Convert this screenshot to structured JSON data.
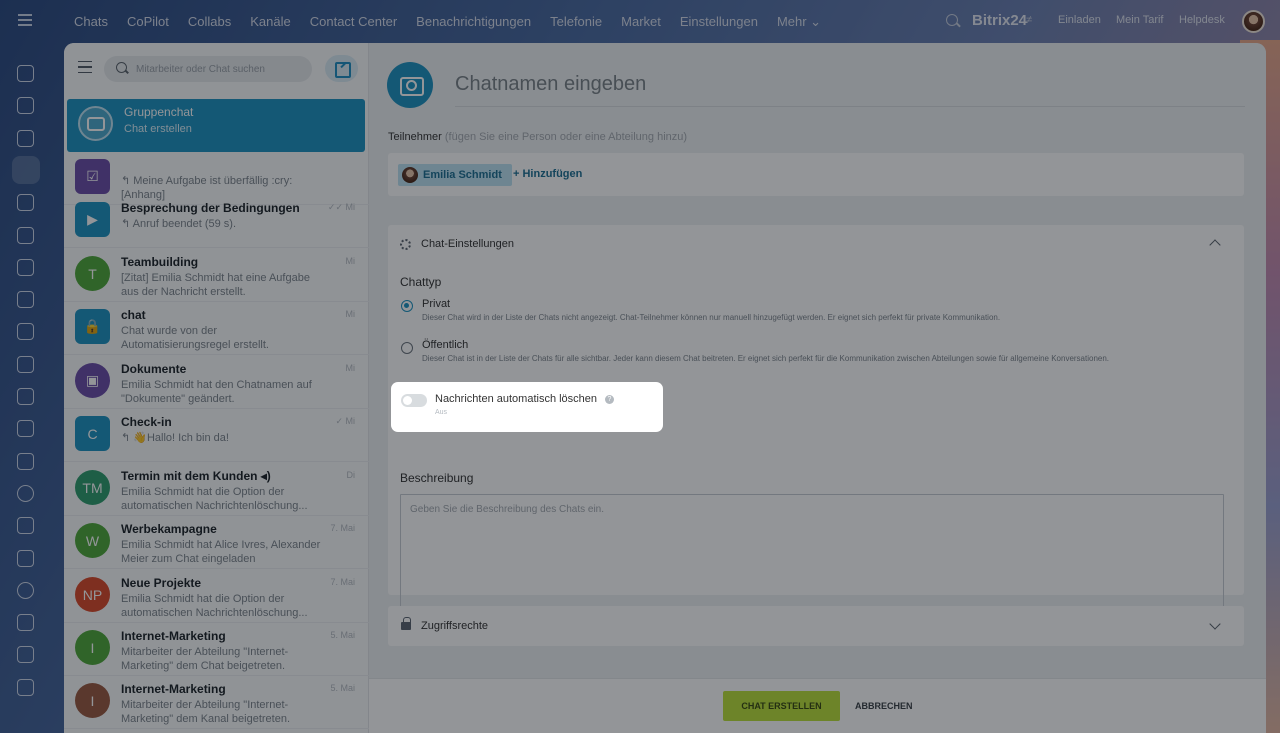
{
  "topbar": {
    "nav": [
      "Chats",
      "CoPilot",
      "Collabs",
      "Kanäle",
      "Contact Center",
      "Benachrichtigungen",
      "Telefonie",
      "Market",
      "Einstellungen",
      "Mehr ⌄"
    ],
    "brand": "Bitrix24",
    "invite": "Einladen",
    "plan": "Mein Tarif",
    "help": "Helpdesk"
  },
  "sidebar_icons": [
    "home-icon",
    "sparkle-icon",
    "tasks-icon",
    "chat-icon",
    "calendar-icon",
    "check-icon",
    "contacts-icon",
    "document-icon",
    "drive-icon",
    "filter-icon",
    "analytics-icon",
    "robot-icon",
    "cart-icon",
    "target-icon",
    "sign-icon",
    "id-card-icon",
    "avatar-si",
    "calendar-2-icon",
    "box-icon",
    "settings-icon"
  ],
  "search": {
    "placeholder": "Mitarbeiter oder Chat suchen"
  },
  "chats": [
    {
      "title": "Gruppenchat",
      "desc": "Chat erstellen",
      "date": "",
      "avatar": "",
      "color": "#7fc3de",
      "selected": true
    },
    {
      "title": "",
      "desc": "↰ Meine Aufgabe ist überfällig :cry: [Anhang]",
      "date": "",
      "avatar": "☑",
      "color": "#6b4ea8"
    },
    {
      "title": "Besprechung der Bedingungen",
      "desc": "↰ Anruf beendet (59 s).",
      "date": "✓✓ Mi",
      "avatar": "▶",
      "color": "#1d93c1"
    },
    {
      "title": "Teambuilding",
      "desc": "[Zitat] Emilia Schmidt hat eine Aufgabe aus der Nachricht erstellt.",
      "date": "Mi",
      "avatar": "T",
      "color": "#4fa83a"
    },
    {
      "title": "chat",
      "desc": "Chat wurde von der Automatisierungsregel erstellt.",
      "date": "Mi",
      "avatar": "🔒",
      "color": "#1d93c1"
    },
    {
      "title": "Dokumente",
      "desc": "Emilia Schmidt hat den Chatnamen auf \"Dokumente\" geändert.",
      "date": "Mi",
      "avatar": "▣",
      "color": "#6b4ea8"
    },
    {
      "title": "Check-in",
      "desc": "↰ 👋Hallo! Ich bin da!",
      "date": "✓ Mi",
      "avatar": "C",
      "color": "#1d93c1"
    },
    {
      "title": "Termin mit dem Kunden ◂)",
      "desc": "Emilia Schmidt hat die Option der automatischen Nachrichtenlöschung...",
      "date": "Di",
      "avatar": "TM",
      "color": "#2f9e6e"
    },
    {
      "title": "Werbekampagne",
      "desc": "Emilia Schmidt hat Alice Ivres, Alexander Meier zum Chat eingeladen",
      "date": "7. Mai",
      "avatar": "W",
      "color": "#4fa83a"
    },
    {
      "title": "Neue Projekte",
      "desc": "Emilia Schmidt hat die Option der automatischen Nachrichtenlöschung...",
      "date": "7. Mai",
      "avatar": "NP",
      "color": "#d94a2a"
    },
    {
      "title": "Internet-Marketing",
      "desc": "Mitarbeiter der Abteilung \"Internet-Marketing\" dem Chat beigetreten.",
      "date": "5. Mai",
      "avatar": "I",
      "color": "#4fa83a"
    },
    {
      "title": "Internet-Marketing",
      "desc": "Mitarbeiter der Abteilung \"Internet-Marketing\" dem Kanal beigetreten.",
      "date": "5. Mai",
      "avatar": "I",
      "color": "#9a5a40"
    }
  ],
  "form": {
    "name_placeholder": "Chatnamen eingeben",
    "participants_label": "Teilnehmer",
    "participants_hint": "(fügen Sie eine Person oder eine Abteilung hinzu)",
    "participant": "Emilia Schmidt",
    "add": "+ Hinzufügen",
    "settings_title": "Chat-Einstellungen",
    "chattype_label": "Chattyp",
    "private_label": "Privat",
    "private_desc": "Dieser Chat wird in der Liste der Chats nicht angezeigt. Chat-Teilnehmer können nur manuell hinzugefügt werden. Er eignet sich perfekt für private Kommunikation.",
    "public_label": "Öffentlich",
    "public_desc": "Dieser Chat ist in der Liste der Chats für alle sichtbar. Jeder kann diesem Chat beitreten. Er eignet sich perfekt für die Kommunikation zwischen Abteilungen sowie für allgemeine Konversationen.",
    "autodelete_label": "Nachrichten automatisch löschen",
    "autodelete_state": "Aus",
    "description_label": "Beschreibung",
    "description_placeholder": "Geben Sie die Beschreibung des Chats ein.",
    "access_label": "Zugriffsrechte",
    "create_button": "CHAT ERSTELLEN",
    "cancel_button": "ABBRECHEN"
  }
}
